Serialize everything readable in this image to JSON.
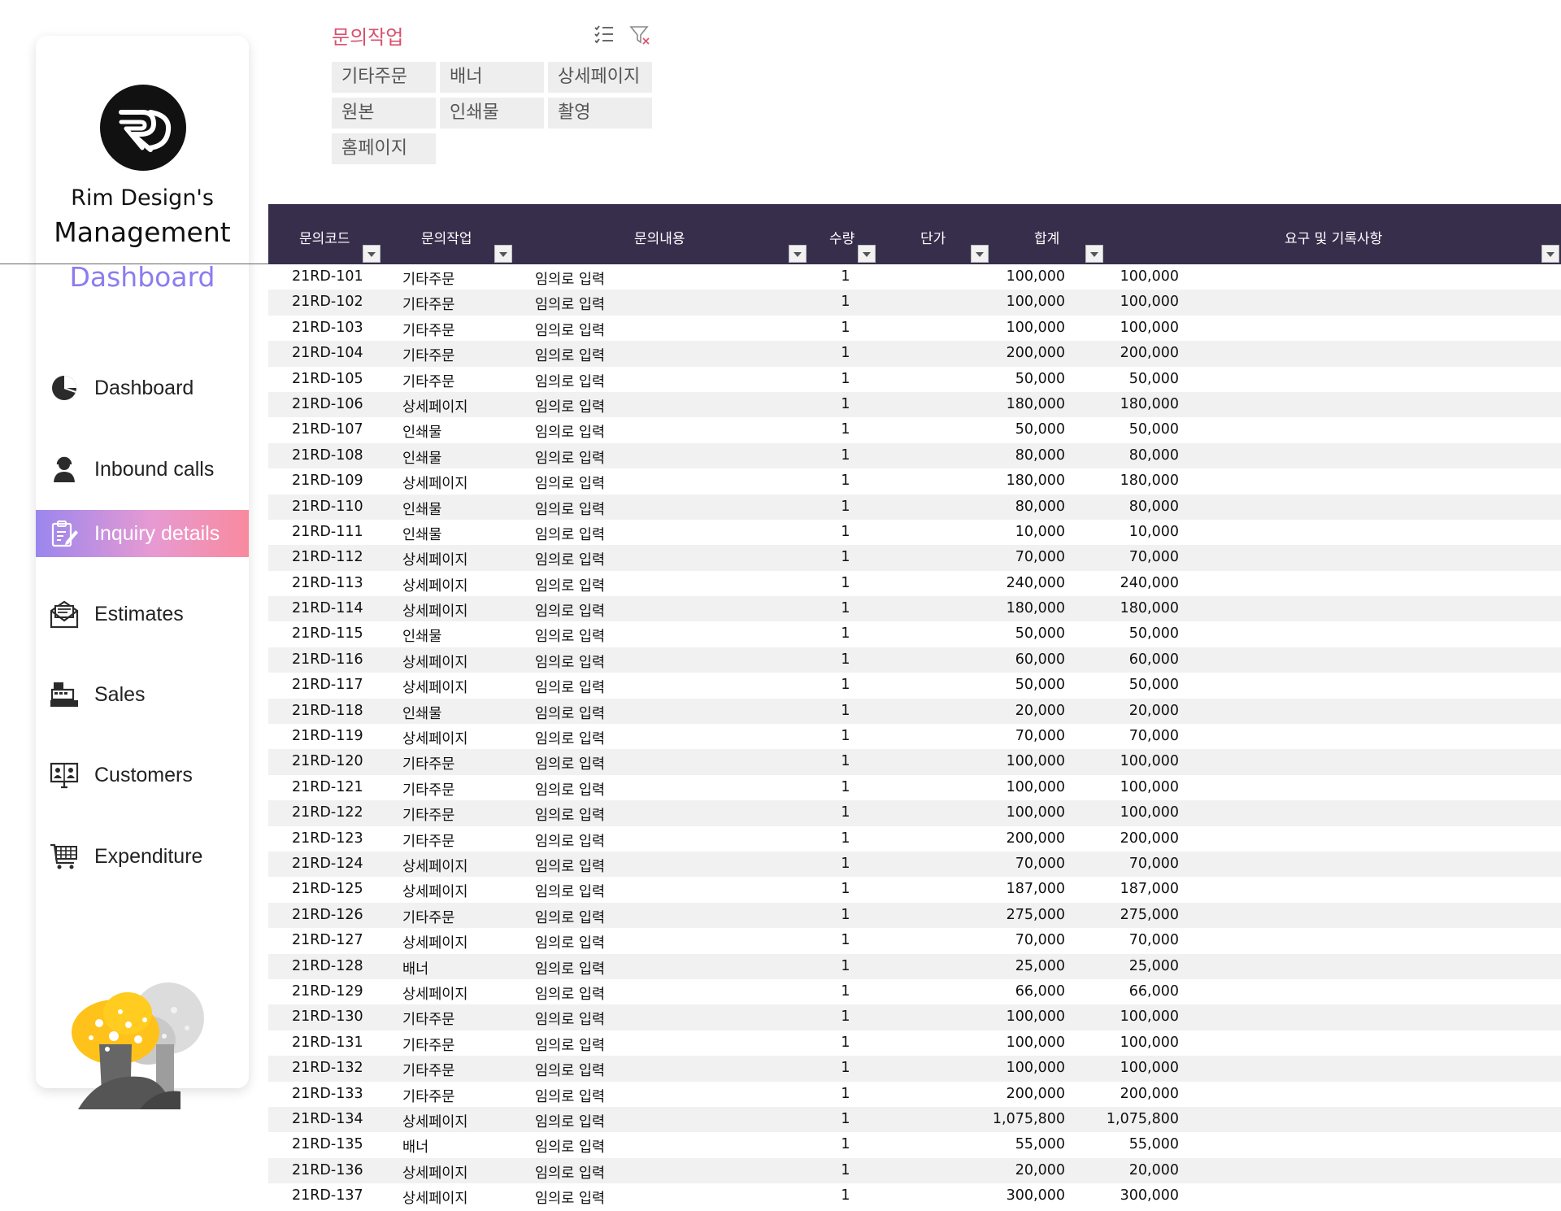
{
  "sidebar": {
    "brand": {
      "line1": "Rim Design's",
      "line2": "Management",
      "line3": "Dashboard"
    },
    "active_gradient": [
      "#9b86ee",
      "#f98a9e"
    ],
    "items": [
      {
        "label": "Dashboard",
        "icon": "pie-chart-icon",
        "active": false
      },
      {
        "label": "Inbound calls",
        "icon": "headset-person-icon",
        "active": false
      },
      {
        "label": "Inquiry details",
        "icon": "clipboard-edit-icon",
        "active": true
      },
      {
        "label": "Estimates",
        "icon": "envelope-document-icon",
        "active": false
      },
      {
        "label": "Sales",
        "icon": "cash-register-icon",
        "active": false
      },
      {
        "label": "Customers",
        "icon": "monitor-users-icon",
        "active": false
      },
      {
        "label": "Expenditure",
        "icon": "shopping-cart-icon",
        "active": false
      }
    ]
  },
  "slicer": {
    "title": "문의작업",
    "title_color": "#d8506c",
    "options": [
      "기타주문",
      "배너",
      "상세페이지",
      "원본",
      "인쇄물",
      "촬영",
      "홈페이지"
    ]
  },
  "table": {
    "header_color": "#372e4c",
    "columns": [
      "문의코드",
      "문의작업",
      "문의내용",
      "수량",
      "단가",
      "합계",
      "요구 및 기록사항"
    ],
    "rows": [
      [
        "21RD-101",
        "기타주문",
        "임의로 입력",
        "1",
        "100,000",
        "100,000"
      ],
      [
        "21RD-102",
        "기타주문",
        "임의로 입력",
        "1",
        "100,000",
        "100,000"
      ],
      [
        "21RD-103",
        "기타주문",
        "임의로 입력",
        "1",
        "100,000",
        "100,000"
      ],
      [
        "21RD-104",
        "기타주문",
        "임의로 입력",
        "1",
        "200,000",
        "200,000"
      ],
      [
        "21RD-105",
        "기타주문",
        "임의로 입력",
        "1",
        "50,000",
        "50,000"
      ],
      [
        "21RD-106",
        "상세페이지",
        "임의로 입력",
        "1",
        "180,000",
        "180,000"
      ],
      [
        "21RD-107",
        "인쇄물",
        "임의로 입력",
        "1",
        "50,000",
        "50,000"
      ],
      [
        "21RD-108",
        "인쇄물",
        "임의로 입력",
        "1",
        "80,000",
        "80,000"
      ],
      [
        "21RD-109",
        "상세페이지",
        "임의로 입력",
        "1",
        "180,000",
        "180,000"
      ],
      [
        "21RD-110",
        "인쇄물",
        "임의로 입력",
        "1",
        "80,000",
        "80,000"
      ],
      [
        "21RD-111",
        "인쇄물",
        "임의로 입력",
        "1",
        "10,000",
        "10,000"
      ],
      [
        "21RD-112",
        "상세페이지",
        "임의로 입력",
        "1",
        "70,000",
        "70,000"
      ],
      [
        "21RD-113",
        "상세페이지",
        "임의로 입력",
        "1",
        "240,000",
        "240,000"
      ],
      [
        "21RD-114",
        "상세페이지",
        "임의로 입력",
        "1",
        "180,000",
        "180,000"
      ],
      [
        "21RD-115",
        "인쇄물",
        "임의로 입력",
        "1",
        "50,000",
        "50,000"
      ],
      [
        "21RD-116",
        "상세페이지",
        "임의로 입력",
        "1",
        "60,000",
        "60,000"
      ],
      [
        "21RD-117",
        "상세페이지",
        "임의로 입력",
        "1",
        "50,000",
        "50,000"
      ],
      [
        "21RD-118",
        "인쇄물",
        "임의로 입력",
        "1",
        "20,000",
        "20,000"
      ],
      [
        "21RD-119",
        "상세페이지",
        "임의로 입력",
        "1",
        "70,000",
        "70,000"
      ],
      [
        "21RD-120",
        "기타주문",
        "임의로 입력",
        "1",
        "100,000",
        "100,000"
      ],
      [
        "21RD-121",
        "기타주문",
        "임의로 입력",
        "1",
        "100,000",
        "100,000"
      ],
      [
        "21RD-122",
        "기타주문",
        "임의로 입력",
        "1",
        "100,000",
        "100,000"
      ],
      [
        "21RD-123",
        "기타주문",
        "임의로 입력",
        "1",
        "200,000",
        "200,000"
      ],
      [
        "21RD-124",
        "상세페이지",
        "임의로 입력",
        "1",
        "70,000",
        "70,000"
      ],
      [
        "21RD-125",
        "상세페이지",
        "임의로 입력",
        "1",
        "187,000",
        "187,000"
      ],
      [
        "21RD-126",
        "기타주문",
        "임의로 입력",
        "1",
        "275,000",
        "275,000"
      ],
      [
        "21RD-127",
        "상세페이지",
        "임의로 입력",
        "1",
        "70,000",
        "70,000"
      ],
      [
        "21RD-128",
        "배너",
        "임의로 입력",
        "1",
        "25,000",
        "25,000"
      ],
      [
        "21RD-129",
        "상세페이지",
        "임의로 입력",
        "1",
        "66,000",
        "66,000"
      ],
      [
        "21RD-130",
        "기타주문",
        "임의로 입력",
        "1",
        "100,000",
        "100,000"
      ],
      [
        "21RD-131",
        "기타주문",
        "임의로 입력",
        "1",
        "100,000",
        "100,000"
      ],
      [
        "21RD-132",
        "기타주문",
        "임의로 입력",
        "1",
        "100,000",
        "100,000"
      ],
      [
        "21RD-133",
        "기타주문",
        "임의로 입력",
        "1",
        "200,000",
        "200,000"
      ],
      [
        "21RD-134",
        "상세페이지",
        "임의로 입력",
        "1",
        "1,075,800",
        "1,075,800"
      ],
      [
        "21RD-135",
        "배너",
        "임의로 입력",
        "1",
        "55,000",
        "55,000"
      ],
      [
        "21RD-136",
        "상세페이지",
        "임의로 입력",
        "1",
        "20,000",
        "20,000"
      ],
      [
        "21RD-137",
        "상세페이지",
        "임의로 입력",
        "1",
        "300,000",
        "300,000"
      ]
    ]
  }
}
